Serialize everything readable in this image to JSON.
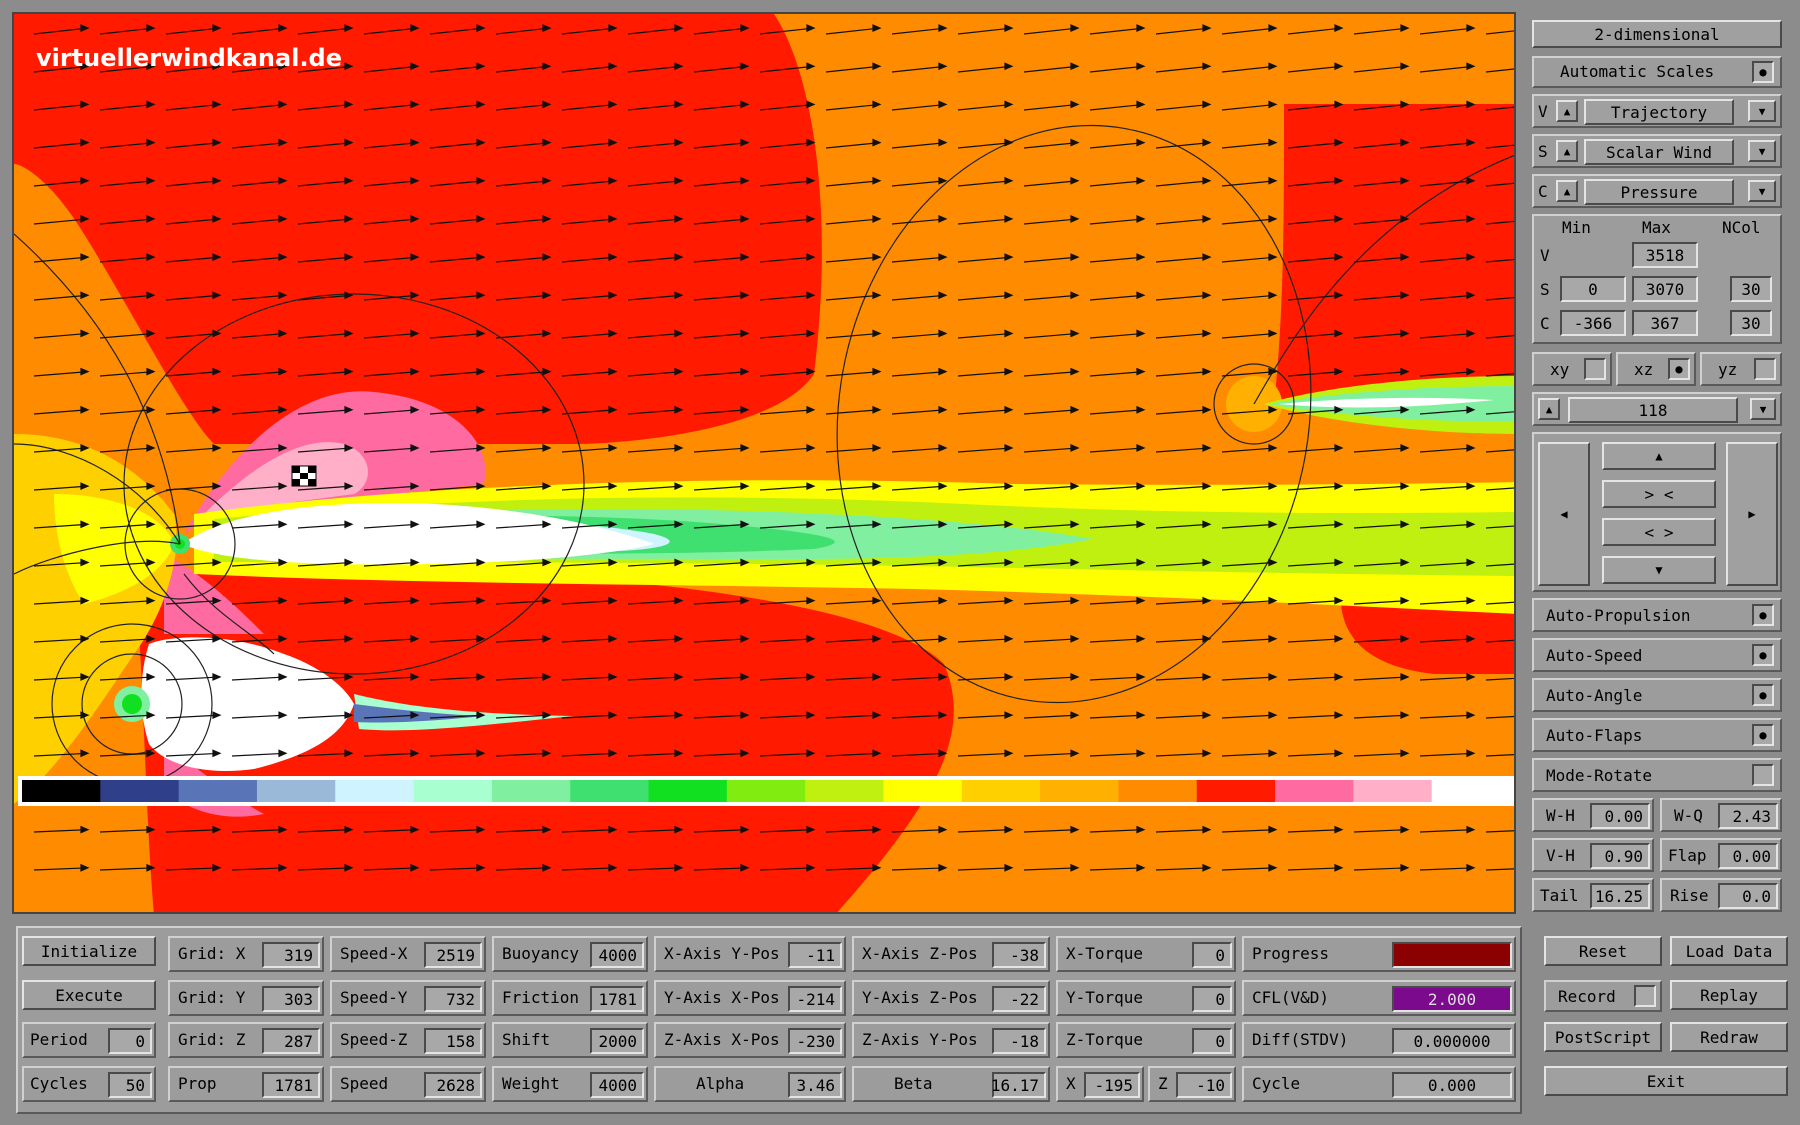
{
  "watermark": "virtuellerwindkanal.de",
  "colors": {
    "bg_orange": "#ff8c00",
    "red": "#ff1a00",
    "pink": "#ff6aa0",
    "lightpink": "#ffb0c8",
    "white": "#ffffff",
    "progress": "#8b0000",
    "cfl": "#7b0a8c"
  },
  "colorbar": [
    "#000000",
    "#2f3f8a",
    "#5a74b8",
    "#9ab8d8",
    "#d0f4ff",
    "#a8ffd0",
    "#80f0a0",
    "#40e070",
    "#10e020",
    "#80ec10",
    "#c0f010",
    "#ffff00",
    "#ffd000",
    "#ffb000",
    "#ff8c00",
    "#ff1a00",
    "#ff6aa0",
    "#ffb0c8",
    "#ffffff"
  ],
  "right": {
    "mode": "2-dimensional",
    "auto_scales": "Automatic Scales",
    "v_label": "V",
    "v_value": "Trajectory",
    "s_label": "S",
    "s_value": "Scalar Wind",
    "c_label": "C",
    "c_value": "Pressure",
    "hdr_min": "Min",
    "hdr_max": "Max",
    "hdr_ncol": "NCol",
    "row_v": "V",
    "v_max": "3518",
    "row_s": "S",
    "s_min": "0",
    "s_max": "3070",
    "s_ncol": "30",
    "row_c": "C",
    "c_min": "-366",
    "c_max": "367",
    "c_ncol": "30",
    "plane_xy": "xy",
    "plane_xz": "xz",
    "plane_yz": "yz",
    "slice": "118",
    "nav_in": "> <",
    "nav_out": "< >",
    "auto_propulsion": "Auto-Propulsion",
    "auto_speed": "Auto-Speed",
    "auto_angle": "Auto-Angle",
    "auto_flaps": "Auto-Flaps",
    "mode_rotate": "Mode-Rotate",
    "wh_label": "W-H",
    "wh_value": "0.00",
    "wq_label": "W-Q",
    "wq_value": "2.43",
    "vh_label": "V-H",
    "vh_value": "0.90",
    "flap_label": "Flap",
    "flap_value": "0.00",
    "tail_label": "Tail",
    "tail_value": "16.25",
    "rise_label": "Rise",
    "rise_value": "0.0"
  },
  "bottom": {
    "initialize": "Initialize",
    "execute": "Execute",
    "period_label": "Period",
    "period_value": "0",
    "cycles_label": "Cycles",
    "cycles_value": "50",
    "gridx_label": "Grid: X",
    "gridx_value": "319",
    "gridy_label": "Grid: Y",
    "gridy_value": "303",
    "gridz_label": "Grid: Z",
    "gridz_value": "287",
    "prop_label": "Prop",
    "prop_value": "1781",
    "speedx_label": "Speed-X",
    "speedx_value": "2519",
    "speedy_label": "Speed-Y",
    "speedy_value": "732",
    "speedz_label": "Speed-Z",
    "speedz_value": "158",
    "speed_label": "Speed",
    "speed_value": "2628",
    "buoy_label": "Buoyancy",
    "buoy_value": "4000",
    "fric_label": "Friction",
    "fric_value": "1781",
    "shift_label": "Shift",
    "shift_value": "2000",
    "weight_label": "Weight",
    "weight_value": "4000",
    "xay_label": "X-Axis Y-Pos",
    "xay_value": "-11",
    "yax_label": "Y-Axis X-Pos",
    "yax_value": "-214",
    "zax_label": "Z-Axis X-Pos",
    "zax_value": "-230",
    "alpha_label": "Alpha",
    "alpha_value": "3.46",
    "xaz_label": "X-Axis Z-Pos",
    "xaz_value": "-38",
    "yaz_label": "Y-Axis Z-Pos",
    "yaz_value": "-22",
    "zay_label": "Z-Axis Y-Pos",
    "zay_value": "-18",
    "beta_label": "Beta",
    "beta_value": "16.17",
    "xt_label": "X-Torque",
    "xt_value": "0",
    "yt_label": "Y-Torque",
    "yt_value": "0",
    "zt_label": "Z-Torque",
    "zt_value": "0",
    "x_label": "X",
    "x_value": "-195",
    "z_label": "Z",
    "z_value": "-10",
    "progress_label": "Progress",
    "cfl_label": "CFL(V&D)",
    "cfl_value": "2.000",
    "diff_label": "Diff(STDV)",
    "diff_value": "0.000000",
    "cycle_label": "Cycle",
    "cycle_value": "0.000",
    "reset": "Reset",
    "load_data": "Load Data",
    "record": "Record",
    "replay": "Replay",
    "postscript": "PostScript",
    "redraw": "Redraw",
    "exit": "Exit"
  }
}
